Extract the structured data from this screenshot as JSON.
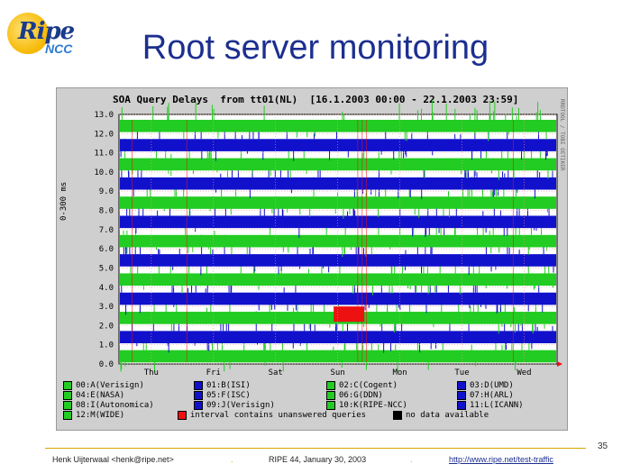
{
  "slide": {
    "title": "Root server monitoring",
    "logo": {
      "text_main": "Ripe",
      "text_sub": "NCC"
    }
  },
  "chart_data": {
    "type": "area",
    "title": "SOA Query Delays  from tt01(NL)  [16.1.2003 00:00 - 22.1.2003 23:59]",
    "side_label": "RRDTOOL / TOBI OETIKER",
    "ylabel": "0-300 ms",
    "yticks": [
      "0.0",
      "1.0",
      "2.0",
      "3.0",
      "4.0",
      "5.0",
      "6.0",
      "7.0",
      "8.0",
      "9.0",
      "10.0",
      "11.0",
      "12.0",
      "13.0"
    ],
    "ylim": [
      0,
      13
    ],
    "xticks": [
      "Thu",
      "Fri",
      "Sat",
      "Sun",
      "Mon",
      "Tue",
      "Wed"
    ],
    "grid": true,
    "series": [
      {
        "name": "00:A(Verisign)",
        "band": 0,
        "color": "#22cc22"
      },
      {
        "name": "01:B(ISI)",
        "band": 1,
        "color": "#1111cc"
      },
      {
        "name": "02:C(Cogent)",
        "band": 2,
        "color": "#22cc22"
      },
      {
        "name": "03:D(UMD)",
        "band": 3,
        "color": "#1111cc"
      },
      {
        "name": "04:E(NASA)",
        "band": 4,
        "color": "#22cc22"
      },
      {
        "name": "05:F(ISC)",
        "band": 5,
        "color": "#1111cc"
      },
      {
        "name": "06:G(DDN)",
        "band": 6,
        "color": "#22cc22"
      },
      {
        "name": "07:H(ARL)",
        "band": 7,
        "color": "#1111cc"
      },
      {
        "name": "08:I(Autonomica)",
        "band": 8,
        "color": "#22cc22"
      },
      {
        "name": "09:J(Verisign)",
        "band": 9,
        "color": "#1111cc"
      },
      {
        "name": "10:K(RIPE-NCC)",
        "band": 10,
        "color": "#22cc22"
      },
      {
        "name": "11:L(ICANN)",
        "band": 11,
        "color": "#1111cc"
      },
      {
        "name": "12:M(WIDE)",
        "band": 12,
        "color": "#22cc22"
      }
    ],
    "legend_extra": [
      {
        "name": "interval contains unanswered queries",
        "color": "#ee1111"
      },
      {
        "name": "no data available",
        "color": "#000000"
      }
    ]
  },
  "footer": {
    "author": "Henk Uijterwaal <henk@ripe.net>",
    "separator": ".",
    "event": "RIPE 44, January 30, 2003",
    "link": "http://www.ripe.net/test-traffic",
    "page_number": "35"
  }
}
